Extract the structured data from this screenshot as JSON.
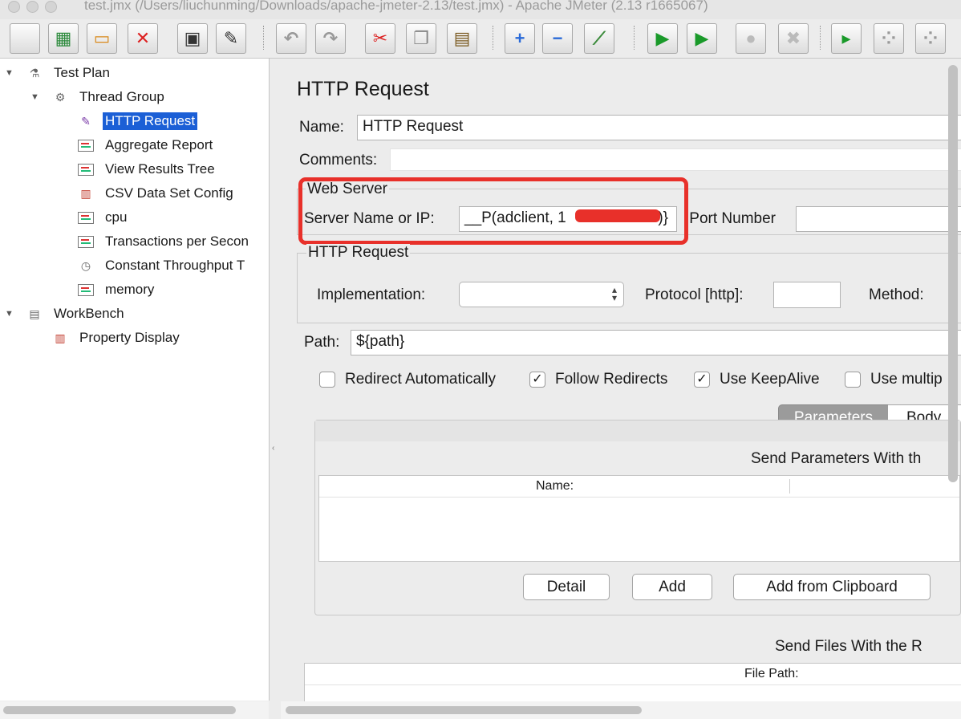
{
  "window": {
    "title": "test.jmx (/Users/liuchunming/Downloads/apache-jmeter-2.13/test.jmx) - Apache JMeter (2.13 r1665067)"
  },
  "toolbar": {
    "buttons": [
      {
        "name": "new-icon",
        "glyph": "",
        "color": "#8a8a8a"
      },
      {
        "name": "templates-icon",
        "glyph": "▦",
        "color": "#2c8a3c"
      },
      {
        "name": "open-icon",
        "glyph": "▭",
        "color": "#d98a1c"
      },
      {
        "name": "close-icon",
        "glyph": "✕",
        "color": "#d22"
      },
      {
        "name": "save-icon",
        "glyph": "▣",
        "color": "#333"
      },
      {
        "name": "save-as-icon",
        "glyph": "✎",
        "color": "#333"
      },
      {
        "name": "undo-icon",
        "glyph": "↶",
        "color": "#999"
      },
      {
        "name": "redo-icon",
        "glyph": "↷",
        "color": "#999"
      },
      {
        "name": "cut-icon",
        "glyph": "✂",
        "color": "#d22"
      },
      {
        "name": "copy-icon",
        "glyph": "❐",
        "color": "#888"
      },
      {
        "name": "paste-icon",
        "glyph": "▤",
        "color": "#7a5a20"
      },
      {
        "name": "expand-icon",
        "glyph": "+",
        "color": "#2a6ad8"
      },
      {
        "name": "collapse-icon",
        "glyph": "−",
        "color": "#2a6ad8"
      },
      {
        "name": "toggle-icon",
        "glyph": "⟋",
        "color": "#3a8a3a"
      },
      {
        "name": "start-icon",
        "glyph": "▶",
        "color": "#1a9a2a"
      },
      {
        "name": "start-no-pause-icon",
        "glyph": "▶",
        "color": "#1a9a2a"
      },
      {
        "name": "stop-icon",
        "glyph": "●",
        "color": "#bbb"
      },
      {
        "name": "shutdown-icon",
        "glyph": "✖",
        "color": "#bbb"
      },
      {
        "name": "remote-start-icon",
        "glyph": "▸",
        "color": "#1a9a2a"
      },
      {
        "name": "remote-stop-icon",
        "glyph": "⁘",
        "color": "#999"
      },
      {
        "name": "remote-exit-icon",
        "glyph": "⁘",
        "color": "#999"
      }
    ]
  },
  "tree": {
    "nodes": [
      {
        "label": "Test Plan",
        "icon": "flask-icon",
        "glyph": "⚗",
        "level": 0,
        "arrow": "▼",
        "selected": false
      },
      {
        "label": "Thread Group",
        "icon": "thread-group-icon",
        "glyph": "⚙",
        "level": 1,
        "arrow": "▼",
        "selected": false
      },
      {
        "label": "HTTP Request",
        "icon": "pipette-icon",
        "glyph": "✎",
        "level": 2,
        "arrow": "",
        "selected": true
      },
      {
        "label": "Aggregate Report",
        "icon": "graph-icon",
        "glyph": "",
        "level": 2,
        "arrow": "",
        "selected": false
      },
      {
        "label": "View Results Tree",
        "icon": "graph-icon",
        "glyph": "",
        "level": 2,
        "arrow": "",
        "selected": false
      },
      {
        "label": "CSV Data Set Config",
        "icon": "config-icon",
        "glyph": "▥",
        "level": 2,
        "arrow": "",
        "selected": false
      },
      {
        "label": "cpu",
        "icon": "graph-icon",
        "glyph": "",
        "level": 2,
        "arrow": "",
        "selected": false
      },
      {
        "label": "Transactions per Secon",
        "icon": "graph-icon",
        "glyph": "",
        "level": 2,
        "arrow": "",
        "selected": false
      },
      {
        "label": "Constant Throughput T",
        "icon": "timer-icon",
        "glyph": "◷",
        "level": 2,
        "arrow": "",
        "selected": false
      },
      {
        "label": "memory",
        "icon": "graph-icon",
        "glyph": "",
        "level": 2,
        "arrow": "",
        "selected": false
      },
      {
        "label": "WorkBench",
        "icon": "workbench-icon",
        "glyph": "▤",
        "level": 0,
        "arrow": "▼",
        "selected": false
      },
      {
        "label": "Property Display",
        "icon": "config-icon",
        "glyph": "▥",
        "level": 1,
        "arrow": "",
        "selected": false
      }
    ]
  },
  "panel": {
    "title": "HTTP Request",
    "name_label": "Name:",
    "name_value": "HTTP Request",
    "comments_label": "Comments:",
    "web_server": {
      "legend": "Web Server",
      "server_label": "Server Name or IP:",
      "server_value": "__P(adclient, 1",
      "server_value_end": "3)}",
      "port_label": "Port Number:",
      "port_value": ""
    },
    "http_request": {
      "legend": "HTTP Request",
      "implementation_label": "Implementation:",
      "implementation_value": "",
      "protocol_label": "Protocol [http]:",
      "protocol_value": "",
      "method_label": "Method:"
    },
    "path_label": "Path:",
    "path_value": "${path}",
    "checkboxes": [
      {
        "label": "Redirect Automatically",
        "checked": false
      },
      {
        "label": "Follow Redirects",
        "checked": true
      },
      {
        "label": "Use KeepAlive",
        "checked": true
      },
      {
        "label": "Use multip",
        "checked": false
      }
    ],
    "tabs": [
      {
        "label": "Parameters",
        "active": true
      },
      {
        "label": "Body",
        "active": false
      }
    ],
    "params_caption": "Send Parameters With th",
    "params_header": "Name:",
    "buttons": {
      "detail": "Detail",
      "add": "Add",
      "add_clipboard": "Add from Clipboard"
    },
    "files_caption": "Send Files With the R",
    "files_header": "File Path:"
  }
}
